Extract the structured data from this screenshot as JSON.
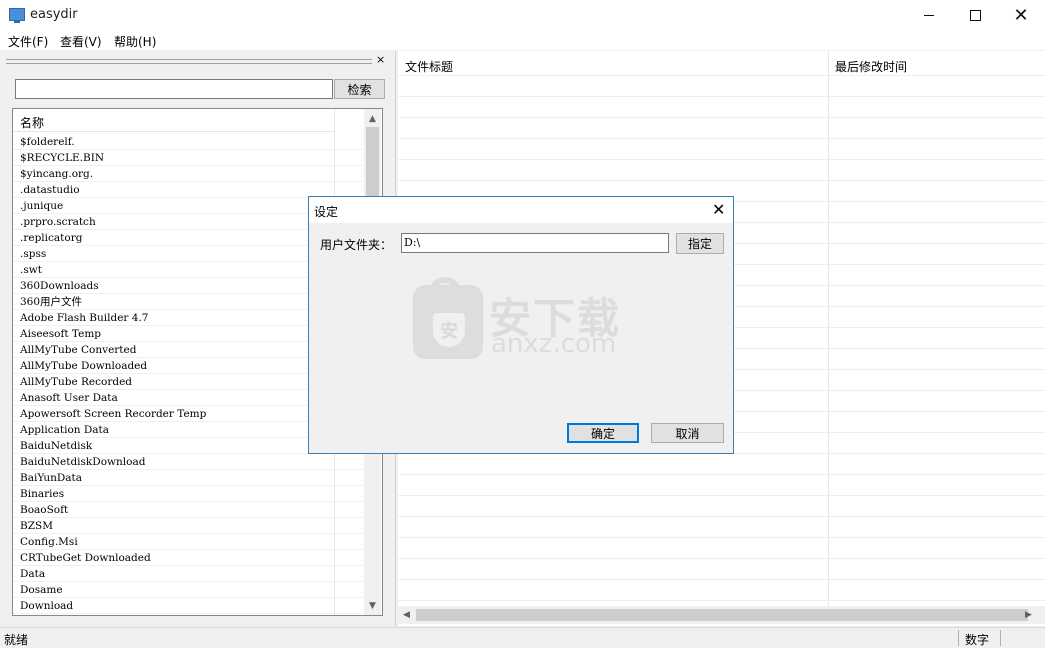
{
  "window": {
    "title": "easydir"
  },
  "menu": [
    "文件(F)",
    "查看(V)",
    "帮助(H)"
  ],
  "left_pane": {
    "close_glyph": "×",
    "search": {
      "value": "",
      "button_label": "检索"
    },
    "list": {
      "header": "名称",
      "items": [
        "$folderelf.",
        "$RECYCLE.BIN",
        "$yincang.org.",
        ".datastudio",
        ".junique",
        ".prpro.scratch",
        ".replicatorg",
        ".spss",
        ".swt",
        "360Downloads",
        "360用户文件",
        "Adobe Flash Builder 4.7",
        "Aiseesoft Temp",
        "AllMyTube Converted",
        "AllMyTube Downloaded",
        "AllMyTube Recorded",
        "Anasoft User Data",
        "Apowersoft Screen Recorder Temp",
        "Application Data",
        "BaiduNetdisk",
        "BaiduNetdiskDownload",
        "BaiYunData",
        "Binaries",
        "BoaoSoft",
        "BZSM",
        "Config.Msi",
        "CRTubeGet Downloaded",
        "Data",
        "Dosame",
        "Download"
      ]
    }
  },
  "grid": {
    "col_title": "文件标题",
    "col_modified": "最后修改时间"
  },
  "dialog": {
    "title": "设定",
    "folder_label": "用户文件夹：",
    "folder_value": "D:\\",
    "browse_label": "指定",
    "ok_label": "确定",
    "cancel_label": "取消",
    "watermark_cn": "安下载",
    "watermark_en": "anxz.com",
    "watermark_badge": "安"
  },
  "statusbar": {
    "left": "就绪",
    "right": "数字"
  },
  "icons": {
    "app": "window-icon",
    "minimize": "minimize-icon",
    "maximize": "maximize-icon",
    "close": "close-icon"
  }
}
